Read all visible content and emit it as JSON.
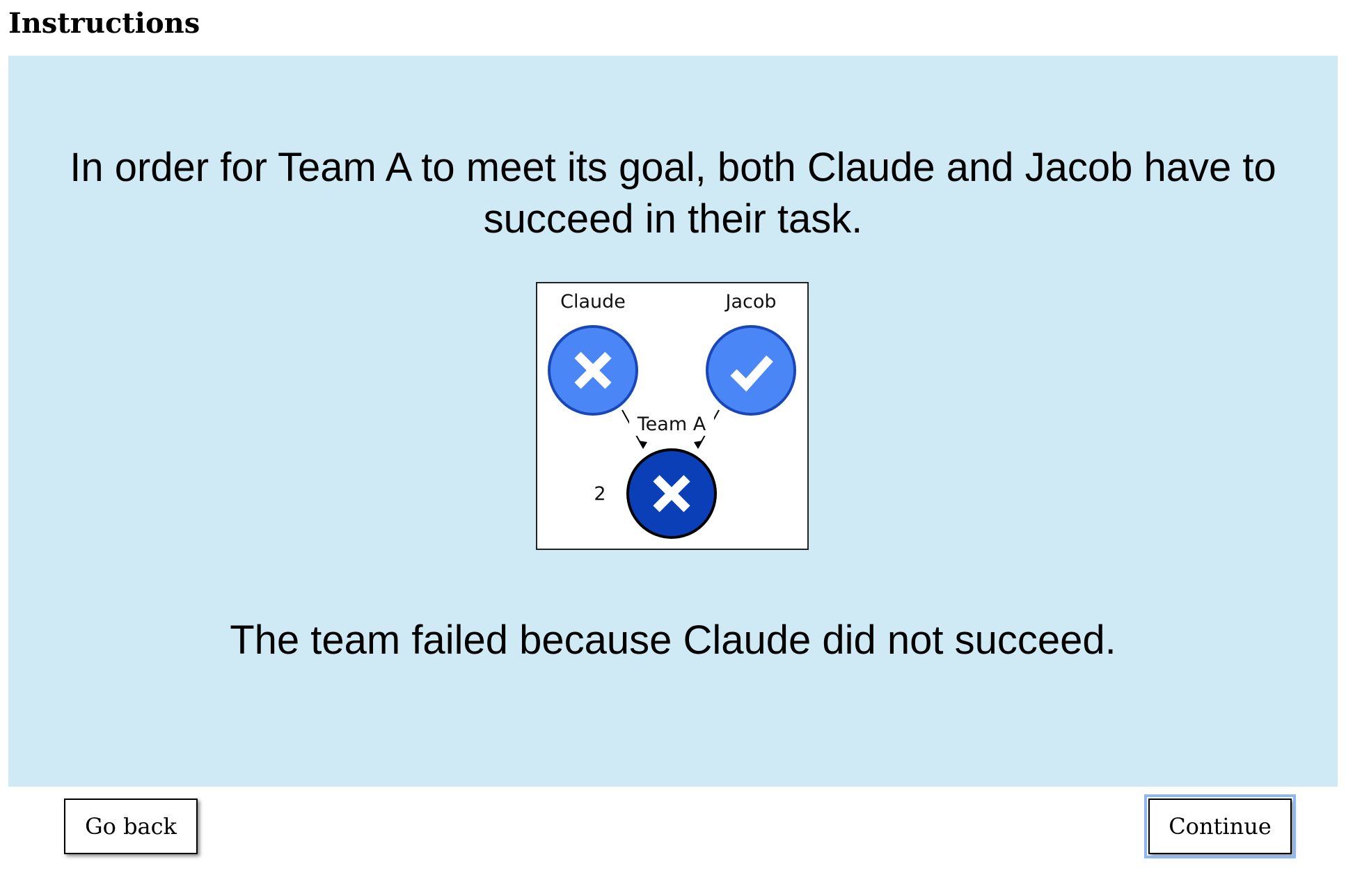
{
  "page": {
    "heading": "Instructions"
  },
  "panel": {
    "goal_text": "In order for Team A to meet its goal, both Claude and Jacob have to succeed in their task.",
    "result_text": "The team failed because Claude did not succeed."
  },
  "diagram": {
    "members": [
      {
        "name": "Claude",
        "outcome": "fail",
        "icon": "x-icon"
      },
      {
        "name": "Jacob",
        "outcome": "success",
        "icon": "check-icon"
      }
    ],
    "team": {
      "label": "Team A",
      "outcome": "fail",
      "icon": "x-icon",
      "number_label": "2"
    },
    "colors": {
      "member_fill": "#4a86f5",
      "member_stroke": "#1a47b8",
      "team_fill": "#0b3fb8",
      "team_stroke": "#000000"
    }
  },
  "buttons": {
    "back_label": "Go back",
    "continue_label": "Continue"
  }
}
